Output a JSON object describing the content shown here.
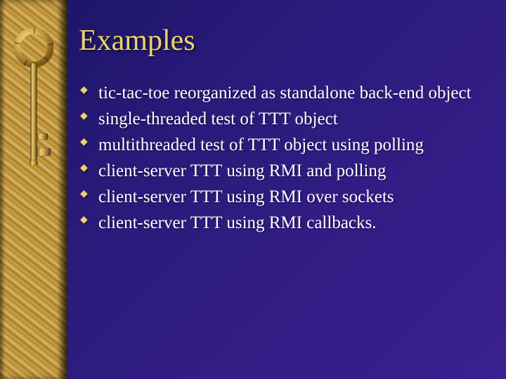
{
  "slide": {
    "title": "Examples",
    "bullets": [
      "tic-tac-toe reorganized as standalone back-end object",
      "single-threaded test of TTT object",
      "multithreaded test of TTT object using polling",
      "client-server TTT using RMI and polling",
      "client-server TTT using RMI over sockets",
      "client-server TTT using RMI callbacks."
    ]
  }
}
